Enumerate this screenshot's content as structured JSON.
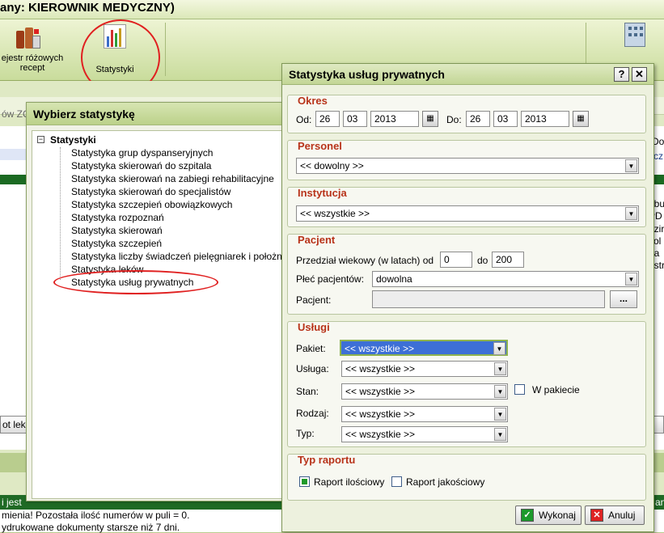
{
  "window": {
    "title": "any: KIEROWNIK MEDYCZNY)"
  },
  "toolbar": {
    "registry_label": "ejestr różowych recept",
    "stats_label": "Statystyki"
  },
  "background": {
    "left_label": "ów ZO",
    "print_btn": "ot leka",
    "right_texts": [
      "Do",
      "ycz",
      "nbu",
      "PD",
      "dzir",
      "kol",
      "na",
      "estr"
    ],
    "strip_left": "i jest",
    "strip_right": "anie",
    "msg1": "mienia! Pozostała ilość numerów w puli = 0.",
    "msg2": "ydrukowane dokumenty starsze niż 7 dni."
  },
  "chooser": {
    "title": "Wybierz statystykę",
    "root": "Statystyki",
    "items": [
      "Statystyka grup dyspanseryjnych",
      "Statystyka skierowań do szpitala",
      "Statystyka skierowań na zabiegi rehabilitacyjne",
      "Statystyka skierowań do specjalistów",
      "Statystyka szczepień obowiązkowych",
      "Statystyka rozpoznań",
      "Statystyka skierowań",
      "Statystyka szczepień",
      "Statystyka liczby świadczeń pielęgniarek i położnych",
      "Statystyka leków",
      "Statystyka usług prywatnych"
    ]
  },
  "dialog": {
    "title": "Statystyka usług prywatnych",
    "help_label": "?",
    "close_label": "✕",
    "okres": {
      "title": "Okres",
      "from_label": "Od:",
      "from_day": "26",
      "from_month": "03",
      "from_year": "2013",
      "to_label": "Do:",
      "to_day": "26",
      "to_month": "03",
      "to_year": "2013"
    },
    "personel": {
      "title": "Personel",
      "value": "<< dowolny >>"
    },
    "instytucja": {
      "title": "Instytucja",
      "value": "<< wszystkie >>"
    },
    "pacjent": {
      "title": "Pacjent",
      "age_label": "Przedział wiekowy (w latach) od",
      "age_from": "0",
      "age_to_label": "do",
      "age_to": "200",
      "sex_label": "Płeć pacjentów:",
      "sex_value": "dowolna",
      "patient_label": "Pacjent:",
      "patient_value": "",
      "browse_label": "..."
    },
    "uslugi": {
      "title": "Usługi",
      "pakiet_label": "Pakiet:",
      "pakiet_value": "<< wszystkie >>",
      "usluga_label": "Usługa:",
      "usluga_value": "<< wszystkie >>",
      "stan_label": "Stan:",
      "stan_value": "<< wszystkie >>",
      "w_pakiecie_label": "W pakiecie",
      "rodzaj_label": "Rodzaj:",
      "rodzaj_value": "<< wszystkie >>",
      "typ_label": "Typ:",
      "typ_value": "<< wszystkie >>"
    },
    "typ_raportu": {
      "title": "Typ raportu",
      "ilosciowy_label": "Raport ilościowy",
      "jakosciowy_label": "Raport jakościowy"
    },
    "execute_label": "Wykonaj",
    "cancel_label": "Anuluj"
  }
}
